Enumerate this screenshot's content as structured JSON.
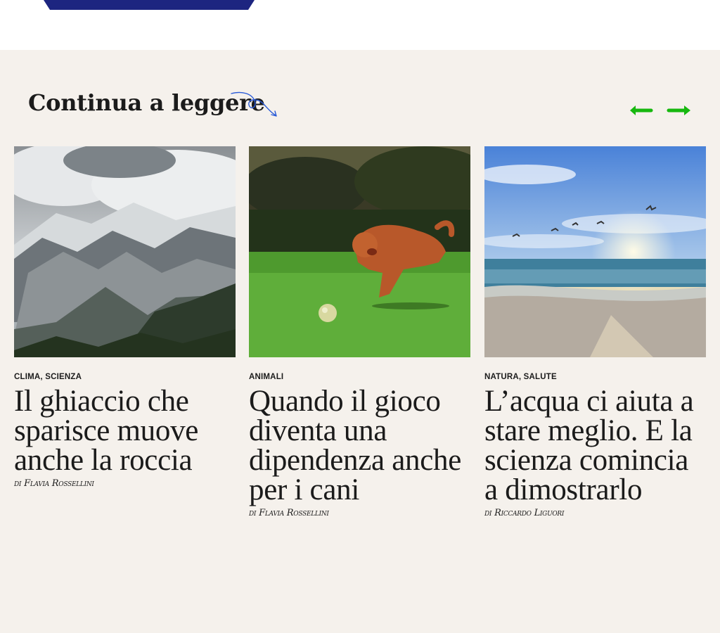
{
  "section": {
    "heading": "Continua a leggere",
    "prev_icon": "arrow-left-icon",
    "next_icon": "arrow-right-icon",
    "accent_color": "#17b80f",
    "squiggle_color": "#2a5bd7"
  },
  "articles": [
    {
      "categories": "CLIMA, SCIENZA",
      "title": "Il ghiaccio che sparisce muove anche la roccia",
      "by": "di",
      "author": "Flavia Rossellini"
    },
    {
      "categories": "ANIMALI",
      "title": "Quando il gioco diventa una dipendenza anche per i cani",
      "by": "di",
      "author": "Flavia Rossellini"
    },
    {
      "categories": "NATURA, SALUTE",
      "title": "L’acqua ci aiuta a stare meglio. E la scienza comincia a dimostrarlo",
      "by": "di",
      "author": "Riccardo Liguori"
    }
  ]
}
